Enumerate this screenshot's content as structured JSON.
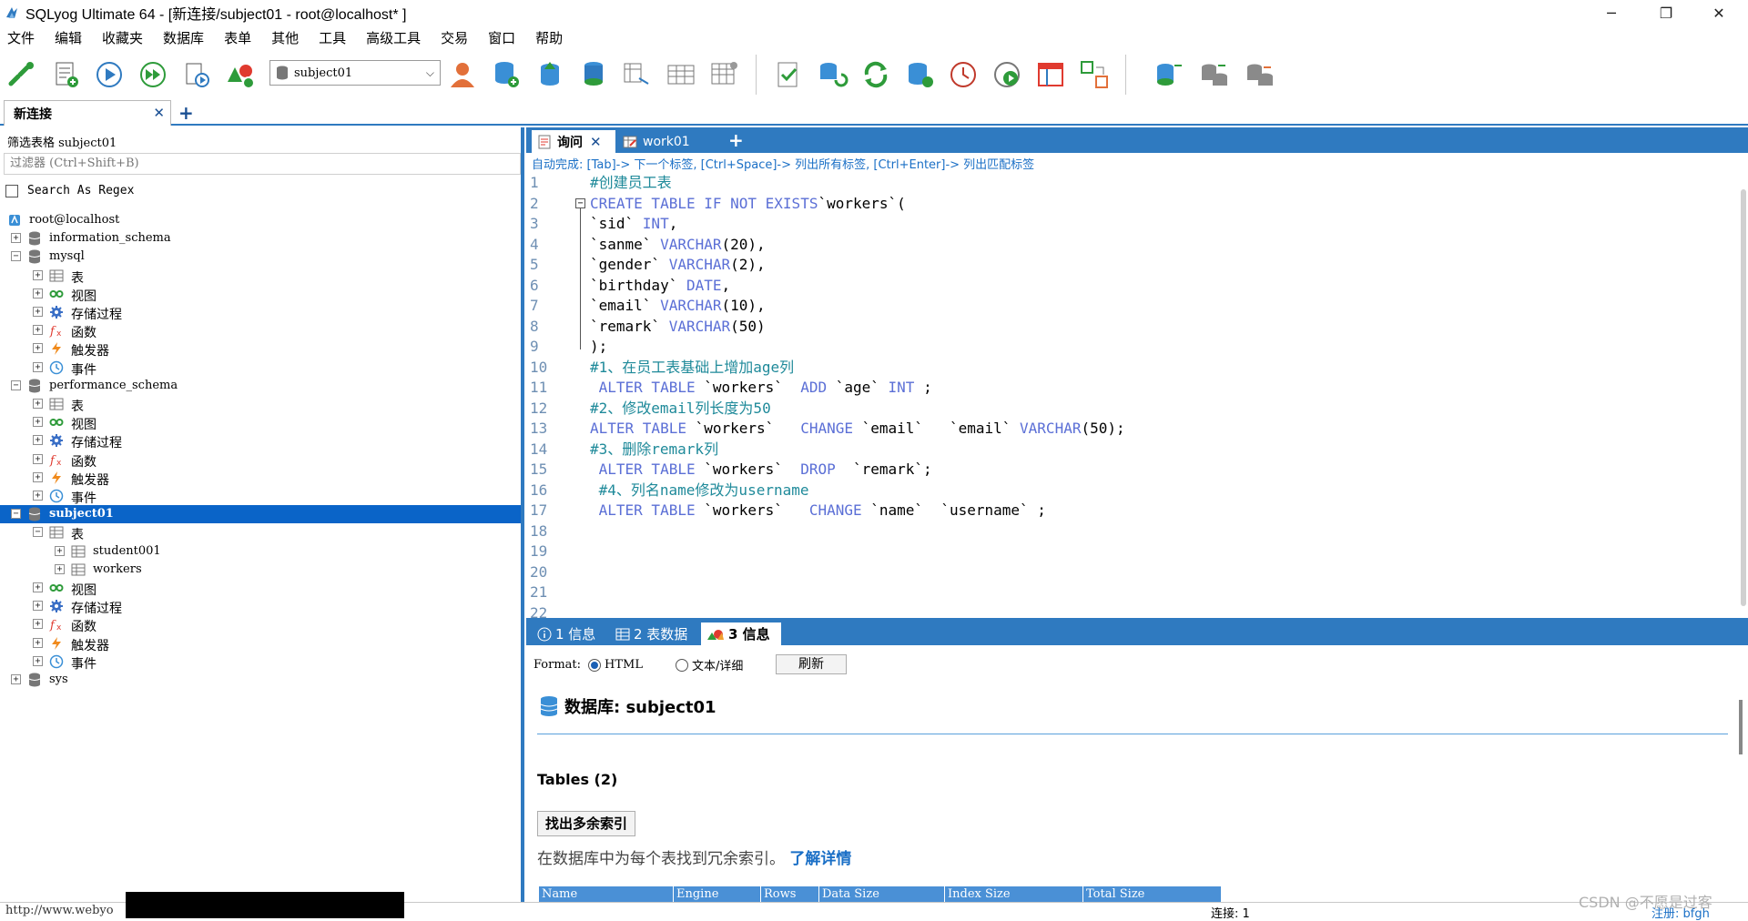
{
  "window": {
    "title": "SQLyog Ultimate 64 - [新连接/subject01 - root@localhost* ]",
    "minimize": "─",
    "restore": "❐",
    "close": "✕"
  },
  "menu": [
    "文件",
    "编辑",
    "收藏夹",
    "数据库",
    "表单",
    "其他",
    "工具",
    "高级工具",
    "交易",
    "窗口",
    "帮助"
  ],
  "toolbar": {
    "database_select": "subject01"
  },
  "connection_tabs": [
    {
      "label": "新连接",
      "close": "✕"
    }
  ],
  "connection_tab_add": "+",
  "left": {
    "filter_label": "筛选表格 subject01",
    "filter_placeholder": "过滤器 (Ctrl+Shift+B)",
    "regex_label": "Search As Regex",
    "tree": [
      {
        "label": "root@localhost",
        "level": 0,
        "icon": "server-icon",
        "exp": ""
      },
      {
        "label": "information_schema",
        "level": 1,
        "icon": "database-icon",
        "exp": "+"
      },
      {
        "label": "mysql",
        "level": 1,
        "icon": "database-icon",
        "exp": "−"
      },
      {
        "label": "表",
        "level": 2,
        "icon": "table-folder-icon",
        "exp": "+"
      },
      {
        "label": "视图",
        "level": 2,
        "icon": "view-icon",
        "exp": "+"
      },
      {
        "label": "存储过程",
        "level": 2,
        "icon": "procedure-icon",
        "exp": "+"
      },
      {
        "label": "函数",
        "level": 2,
        "icon": "function-icon",
        "exp": "+"
      },
      {
        "label": "触发器",
        "level": 2,
        "icon": "trigger-icon",
        "exp": "+"
      },
      {
        "label": "事件",
        "level": 2,
        "icon": "event-icon",
        "exp": "+"
      },
      {
        "label": "performance_schema",
        "level": 1,
        "icon": "database-icon",
        "exp": "−"
      },
      {
        "label": "表",
        "level": 2,
        "icon": "table-folder-icon",
        "exp": "+"
      },
      {
        "label": "视图",
        "level": 2,
        "icon": "view-icon",
        "exp": "+"
      },
      {
        "label": "存储过程",
        "level": 2,
        "icon": "procedure-icon",
        "exp": "+"
      },
      {
        "label": "函数",
        "level": 2,
        "icon": "function-icon",
        "exp": "+"
      },
      {
        "label": "触发器",
        "level": 2,
        "icon": "trigger-icon",
        "exp": "+"
      },
      {
        "label": "事件",
        "level": 2,
        "icon": "event-icon",
        "exp": "+"
      },
      {
        "label": "subject01",
        "level": 1,
        "icon": "database-icon",
        "exp": "−",
        "selected": true
      },
      {
        "label": "表",
        "level": 2,
        "icon": "table-folder-icon",
        "exp": "−"
      },
      {
        "label": "student001",
        "level": 3,
        "icon": "table-icon",
        "exp": "+"
      },
      {
        "label": "workers",
        "level": 3,
        "icon": "table-icon",
        "exp": "+"
      },
      {
        "label": "视图",
        "level": 2,
        "icon": "view-icon",
        "exp": "+"
      },
      {
        "label": "存储过程",
        "level": 2,
        "icon": "procedure-icon",
        "exp": "+"
      },
      {
        "label": "函数",
        "level": 2,
        "icon": "function-icon",
        "exp": "+"
      },
      {
        "label": "触发器",
        "level": 2,
        "icon": "trigger-icon",
        "exp": "+"
      },
      {
        "label": "事件",
        "level": 2,
        "icon": "event-icon",
        "exp": "+"
      },
      {
        "label": "sys",
        "level": 1,
        "icon": "database-icon",
        "exp": "+"
      }
    ]
  },
  "editor": {
    "tabs": [
      {
        "label": "询问",
        "active": true,
        "close": "✕"
      },
      {
        "label": "work01",
        "active": false
      }
    ],
    "tab_add": "+",
    "autocomplete_hint": "自动完成: [Tab]-> 下一个标签, [Ctrl+Space]-> 列出所有标签, [Ctrl+Enter]-> 列出匹配标签",
    "lines": [
      {
        "n": "1",
        "t": [
          {
            "c": "cm",
            "s": "#创建员工表"
          }
        ]
      },
      {
        "n": "2",
        "fold": "−",
        "t": [
          {
            "c": "kw",
            "s": "CREATE TABLE IF NOT EXISTS"
          },
          {
            "c": "tx",
            "s": "`workers`("
          }
        ]
      },
      {
        "n": "3",
        "t": [
          {
            "c": "tx",
            "s": "`sid` "
          },
          {
            "c": "ty",
            "s": "INT"
          },
          {
            "c": "tx",
            "s": ","
          }
        ]
      },
      {
        "n": "4",
        "t": [
          {
            "c": "tx",
            "s": "`sanme` "
          },
          {
            "c": "ty",
            "s": "VARCHAR"
          },
          {
            "c": "tx",
            "s": "(20),"
          }
        ]
      },
      {
        "n": "5",
        "t": [
          {
            "c": "tx",
            "s": "`gender` "
          },
          {
            "c": "ty",
            "s": "VARCHAR"
          },
          {
            "c": "tx",
            "s": "(2),"
          }
        ]
      },
      {
        "n": "6",
        "t": [
          {
            "c": "tx",
            "s": "`birthday` "
          },
          {
            "c": "ty",
            "s": "DATE"
          },
          {
            "c": "tx",
            "s": ","
          }
        ]
      },
      {
        "n": "7",
        "t": [
          {
            "c": "tx",
            "s": "`email` "
          },
          {
            "c": "ty",
            "s": "VARCHAR"
          },
          {
            "c": "tx",
            "s": "(10),"
          }
        ]
      },
      {
        "n": "8",
        "t": [
          {
            "c": "tx",
            "s": "`remark` "
          },
          {
            "c": "ty",
            "s": "VARCHAR"
          },
          {
            "c": "tx",
            "s": "(50)"
          }
        ]
      },
      {
        "n": "9",
        "t": [
          {
            "c": "tx",
            "s": ");"
          }
        ]
      },
      {
        "n": "10",
        "t": [
          {
            "c": "cm",
            "s": "#1、在员工表基础上增加age列"
          }
        ]
      },
      {
        "n": "11",
        "t": [
          {
            "c": "kw",
            "s": " ALTER TABLE"
          },
          {
            "c": "tx",
            "s": " `workers`  "
          },
          {
            "c": "kw",
            "s": "ADD"
          },
          {
            "c": "tx",
            "s": " `age` "
          },
          {
            "c": "ty",
            "s": "INT"
          },
          {
            "c": "tx",
            "s": " ;"
          }
        ]
      },
      {
        "n": "12",
        "t": [
          {
            "c": "cm",
            "s": "#2、修改email列长度为50"
          }
        ]
      },
      {
        "n": "13",
        "t": [
          {
            "c": "kw",
            "s": "ALTER TABLE"
          },
          {
            "c": "tx",
            "s": " `workers`   "
          },
          {
            "c": "kw",
            "s": "CHANGE"
          },
          {
            "c": "tx",
            "s": " `email`   `email` "
          },
          {
            "c": "ty",
            "s": "VARCHAR"
          },
          {
            "c": "tx",
            "s": "(50);"
          }
        ]
      },
      {
        "n": "14",
        "t": [
          {
            "c": "cm",
            "s": "#3、删除remark列"
          }
        ]
      },
      {
        "n": "15",
        "t": [
          {
            "c": "kw",
            "s": " ALTER TABLE"
          },
          {
            "c": "tx",
            "s": " `workers`  "
          },
          {
            "c": "kw",
            "s": "DROP"
          },
          {
            "c": "tx",
            "s": "  `remark`;"
          }
        ]
      },
      {
        "n": "16",
        "t": [
          {
            "c": "cm",
            "s": " #4、列名name修改为username"
          }
        ]
      },
      {
        "n": "17",
        "t": [
          {
            "c": "kw",
            "s": " ALTER TABLE"
          },
          {
            "c": "tx",
            "s": " `workers`   "
          },
          {
            "c": "kw",
            "s": "CHANGE"
          },
          {
            "c": "tx",
            "s": " `name`  `username` ;"
          }
        ]
      },
      {
        "n": "18",
        "t": []
      },
      {
        "n": "19",
        "t": []
      },
      {
        "n": "20",
        "t": []
      },
      {
        "n": "21",
        "t": []
      },
      {
        "n": "22",
        "t": []
      }
    ]
  },
  "results": {
    "tabs": [
      {
        "label": "1 信息",
        "icon": "info-icon"
      },
      {
        "label": "2 表数据",
        "icon": "grid-icon"
      },
      {
        "label": "3 信息",
        "icon": "chart-icon",
        "active": true
      }
    ],
    "format_label": "Format:",
    "format_html": "HTML",
    "format_text": "文本/详细",
    "refresh": "刷新",
    "db_heading": "数据库: subject01",
    "tables_heading": "Tables (2)",
    "redundant_button": "找出多余索引",
    "redundant_text": "在数据库中为每个表找到冗余索引。",
    "learn_more": "了解详情",
    "columns": [
      "Name",
      "Engine",
      "Rows",
      "Data Size",
      "Index Size",
      "Total Size"
    ]
  },
  "status": {
    "url": "http://www.webyo",
    "connections": "连接: 1",
    "register": "注册: bfgh",
    "watermark": "CSDN @不愿是过客"
  },
  "colors": {
    "accent": "#2f7ac0",
    "selection": "#0a64c8",
    "keyword": "#5b6fd6",
    "comment": "#1f8a9a",
    "link": "#1a6fc6"
  }
}
